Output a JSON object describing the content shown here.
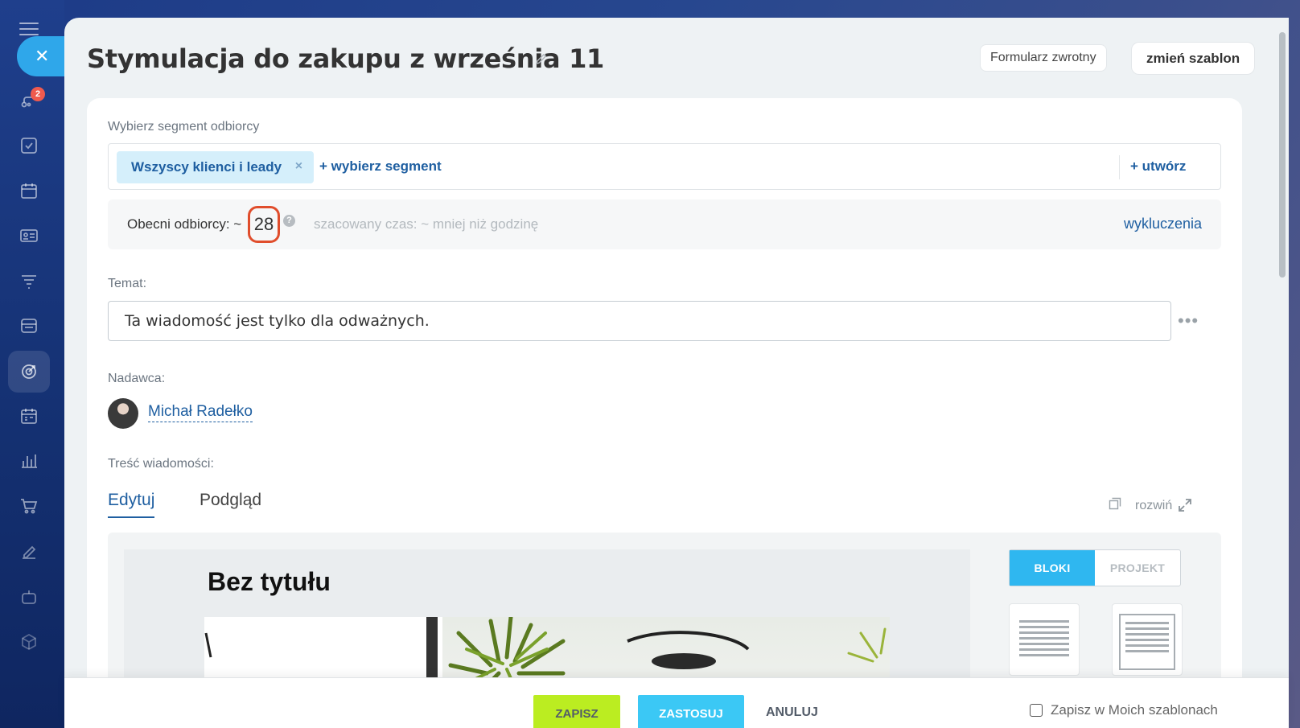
{
  "header": {
    "title": "Stymulacja do zakupu z września 11",
    "feedback_label": "Formularz zwrotny",
    "change_template_label": "zmień szablon"
  },
  "sidebar": {
    "notification_count": "2",
    "items": [
      {
        "icon": "menu-icon"
      },
      {
        "icon": "close-icon"
      },
      {
        "icon": "flow-icon"
      },
      {
        "icon": "tasks-icon"
      },
      {
        "icon": "calendar-icon"
      },
      {
        "icon": "contact-card-icon"
      },
      {
        "icon": "funnel-icon"
      },
      {
        "icon": "store-icon"
      },
      {
        "icon": "marketing-target-icon"
      },
      {
        "icon": "schedule-icon"
      },
      {
        "icon": "analytics-icon"
      },
      {
        "icon": "cart-icon"
      },
      {
        "icon": "sign-icon"
      },
      {
        "icon": "robot-icon"
      },
      {
        "icon": "box-icon"
      }
    ]
  },
  "segment": {
    "label": "Wybierz segment odbiorcy",
    "selected_chip": "Wszyscy klienci i leady",
    "chip_remove": "×",
    "add_segment": "+ wybierz segment",
    "create": "+ utwórz"
  },
  "recipients": {
    "label": "Obecni odbiorcy: ~",
    "count": "28",
    "help": "?",
    "estimated_time": "szacowany czas: ~ mniej niż godzinę",
    "exclusions": "wykluczenia"
  },
  "subject": {
    "label": "Temat:",
    "value": "Ta wiadomość jest tylko dla odważnych.",
    "more": "•••"
  },
  "sender": {
    "label": "Nadawca:",
    "name": "Michał Radełko"
  },
  "content": {
    "label": "Treść wiadomości:",
    "tabs": [
      {
        "label": "Edytuj",
        "active": true
      },
      {
        "label": "Podgląd",
        "active": false
      }
    ],
    "expand_label": "rozwiń",
    "canvas_title": "Bez tytułu",
    "modes": {
      "blocks": "BLOKI",
      "project": "PROJEKT"
    }
  },
  "footer": {
    "save": "ZAPISZ",
    "apply": "ZASTOSUJ",
    "cancel": "ANULUJ",
    "save_template": "Zapisz w Moich szablonach"
  },
  "colors": {
    "accent_blue": "#1f5fa1",
    "save_green": "#bbed21",
    "apply_blue": "#3bc8f5",
    "highlight_red": "#e04d2c"
  }
}
